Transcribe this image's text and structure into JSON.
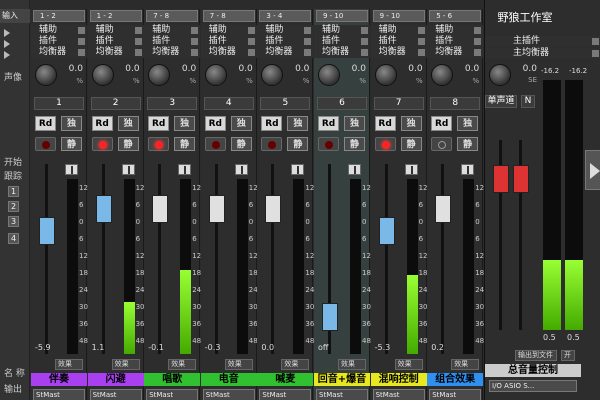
{
  "left_panel": {
    "input_label": "输入",
    "labels": {
      "pan": "声像",
      "start": "开始",
      "track": "跟踪",
      "name": "名 称",
      "output": "输出"
    },
    "buttons": [
      "1",
      "2",
      "3",
      "4"
    ]
  },
  "sends": [
    "辅助",
    "插件",
    "均衡器"
  ],
  "channels": [
    {
      "input": "1 - 2",
      "number": "1",
      "knob": "0.0",
      "knob_pct": "%",
      "peak": "-5.9",
      "fx": "效果",
      "name": "伴奏",
      "name_color": "#a840f0",
      "output": "StMast",
      "fader_y": 0.28,
      "meter": 0.0,
      "rec": "dark",
      "fader_color": "#7ab8e8"
    },
    {
      "input": "1 - 2",
      "number": "2",
      "knob": "0.0",
      "knob_pct": "%",
      "peak": "1.1",
      "fx": "效果",
      "name": "闪避",
      "name_color": "#a840f0",
      "output": "StMast",
      "fader_y": 0.14,
      "meter": 0.3,
      "rec": "on",
      "fader_color": "#7ab8e8"
    },
    {
      "input": "7 - 8",
      "number": "3",
      "knob": "0.0",
      "knob_pct": "%",
      "peak": "-0.1",
      "fx": "效果",
      "name": "唱歌",
      "name_color": "#30c030",
      "output": "StMast",
      "fader_y": 0.14,
      "meter": 0.48,
      "rec": "on",
      "fader_color": "#e0e0e0"
    },
    {
      "input": "7 - 8",
      "number": "4",
      "knob": "0.0",
      "knob_pct": "%",
      "peak": "-0.3",
      "fx": "效果",
      "name": "电音",
      "name_color": "#30c030",
      "output": "StMast",
      "fader_y": 0.14,
      "meter": 0.0,
      "rec": "dark",
      "fader_color": "#e0e0e0"
    },
    {
      "input": "3 - 4",
      "number": "5",
      "knob": "0.0",
      "knob_pct": "%",
      "peak": "0.0",
      "fx": "效果",
      "name": "喊麦",
      "name_color": "#30c030",
      "output": "StMast",
      "fader_y": 0.14,
      "meter": 0.0,
      "rec": "dark",
      "fader_color": "#e0e0e0"
    },
    {
      "input": "9 - 10",
      "number": "6",
      "knob": "0.0",
      "knob_pct": "%",
      "peak": "off",
      "fx": "效果",
      "name": "回音+爆音",
      "name_color": "#e8e820",
      "output": "StMast",
      "fader_y": 0.85,
      "meter": 0.0,
      "rec": "dark",
      "fader_color": "#7ab8e8"
    },
    {
      "input": "9 - 10",
      "number": "7",
      "knob": "0.0",
      "knob_pct": "%",
      "peak": "-5.3",
      "fx": "效果",
      "name": "混响控制",
      "name_color": "#e8e820",
      "output": "StMast",
      "fader_y": 0.28,
      "meter": 0.45,
      "rec": "on",
      "fader_color": "#7ab8e8"
    },
    {
      "input": "5 - 6",
      "number": "8",
      "knob": "0.0",
      "knob_pct": "%",
      "peak": "0.2",
      "fx": "效果",
      "name": "组合效果",
      "name_color": "#3090f0",
      "output": "StMast",
      "fader_y": 0.14,
      "meter": 0.0,
      "rec": "outline",
      "fader_color": "#e0e0e0"
    }
  ],
  "scale_ticks": [
    "12",
    "6",
    "0",
    "6",
    "12",
    "18",
    "24",
    "30",
    "36",
    "48"
  ],
  "master": {
    "title": "野狼工作室",
    "sends": [
      "主插件",
      "主均衡器"
    ],
    "knob": "0.0",
    "knob_pct": "SE",
    "number_label": "单声道",
    "n_label": "N",
    "peak_left": "-16.2",
    "peak_right": "-16.2",
    "peak_bottom_l": "0.5",
    "peak_bottom_r": "0.5",
    "fx": "输出到文件",
    "open": "开",
    "name": "总音量控制",
    "output": "I/O ASIO S...",
    "meter": 0.4
  }
}
